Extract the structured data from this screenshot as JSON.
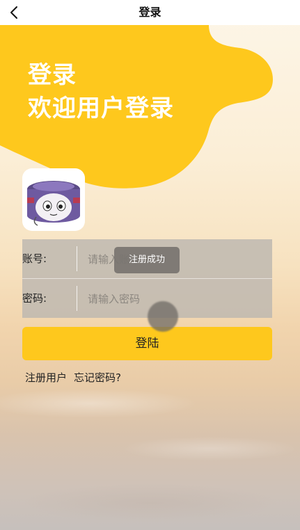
{
  "navbar": {
    "title": "登录",
    "back_icon": "chevron-left-icon"
  },
  "hero": {
    "line1": "登录",
    "line2": "欢迎用户登录"
  },
  "colors": {
    "accent": "#fec81d",
    "navbar_bg": "#ffffff",
    "hero_text": "#ffffff"
  },
  "form": {
    "account_label": "账号:",
    "account_placeholder": "请输入账号",
    "password_label": "密码:",
    "password_placeholder": "请输入密码"
  },
  "login_button": "登陆",
  "links": {
    "register": "注册用户",
    "forgot": "忘记密码?"
  },
  "toast": "注册成功"
}
